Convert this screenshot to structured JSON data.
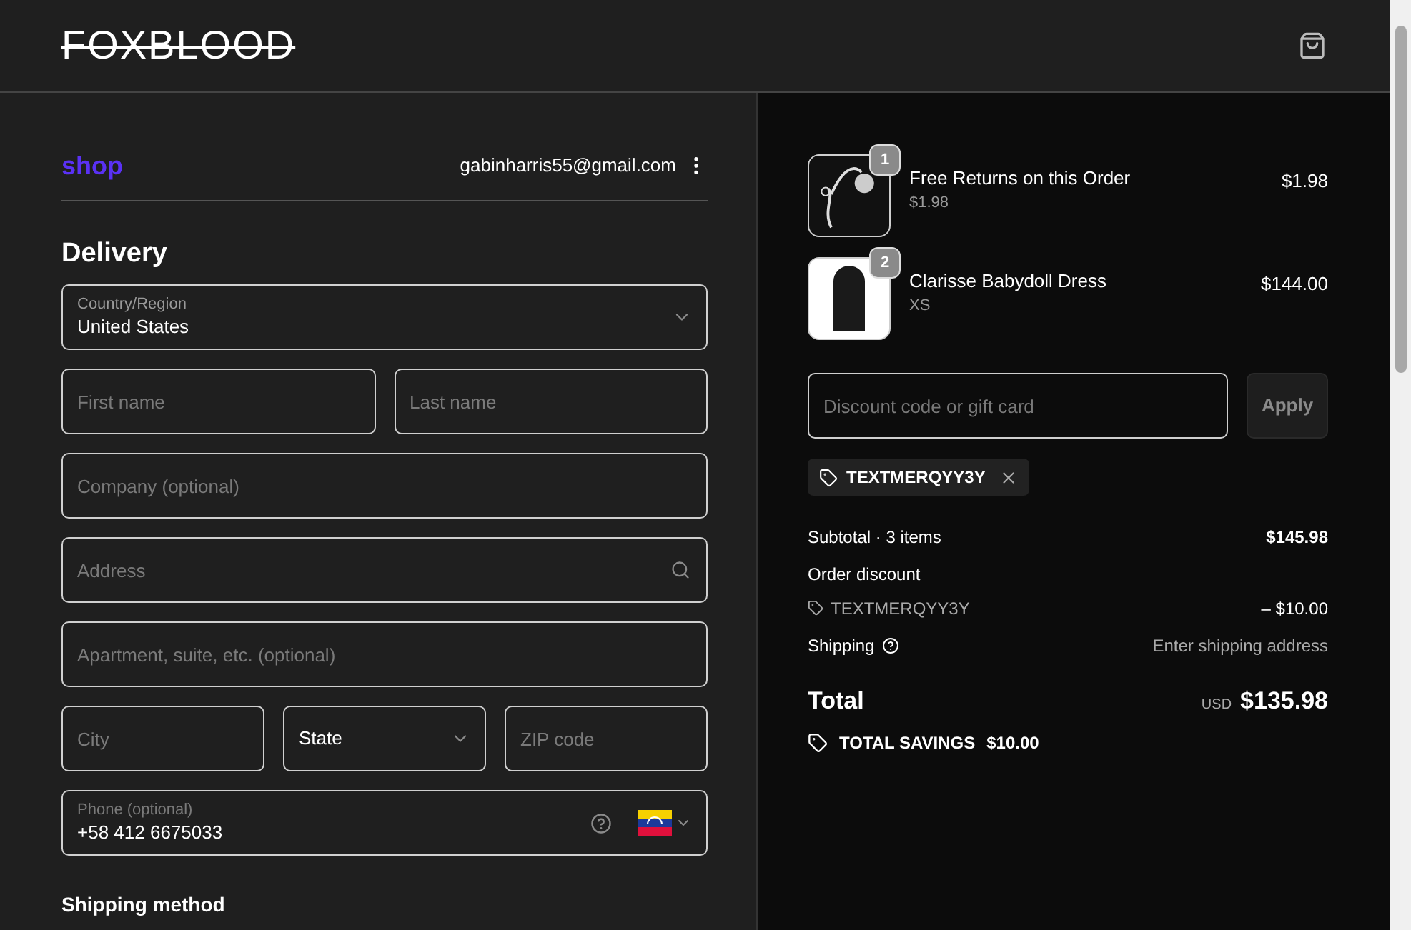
{
  "header": {
    "logo": "FOXBLOOD"
  },
  "account": {
    "shop": "shop",
    "email": "gabinharris55@gmail.com"
  },
  "delivery": {
    "title": "Delivery",
    "rows": [
      [
        {
          "kind": "select",
          "label": "Country/Region",
          "value": "United States"
        }
      ],
      [
        {
          "kind": "text",
          "placeholder": "First name"
        },
        {
          "kind": "text",
          "placeholder": "Last name"
        }
      ],
      [
        {
          "kind": "text",
          "placeholder": "Company (optional)"
        }
      ],
      [
        {
          "kind": "search",
          "placeholder": "Address"
        }
      ],
      [
        {
          "kind": "text",
          "placeholder": "Apartment, suite, etc. (optional)"
        }
      ],
      [
        {
          "kind": "text",
          "placeholder": "City"
        },
        {
          "kind": "select",
          "value": "State"
        },
        {
          "kind": "text",
          "placeholder": "ZIP code"
        }
      ],
      [
        {
          "kind": "phone",
          "label": "Phone (optional)",
          "value": "+58 412 6675033"
        }
      ]
    ]
  },
  "shipping_method": {
    "title": "Shipping method"
  },
  "cart": {
    "items": [
      {
        "name": "Free Returns on this Order",
        "detail": "$1.98",
        "price": "$1.98",
        "quantity": "1",
        "kind": "drawing"
      },
      {
        "name": "Clarisse Babydoll Dress",
        "detail": "XS",
        "price": "$144.00",
        "quantity": "2",
        "kind": "photo"
      }
    ],
    "discount": {
      "placeholder": "Discount code or gift card",
      "button": "Apply"
    },
    "applied_code": "TEXTMERQYY3Y",
    "subtotal": {
      "label": "Subtotal · 3 items",
      "value": "$145.98"
    },
    "order_discount": {
      "label": "Order discount",
      "code": "TEXTMERQYY3Y",
      "value": "– $10.00"
    },
    "shipping": {
      "label": "Shipping",
      "value": "Enter shipping address"
    },
    "total": {
      "label": "Total",
      "currency": "USD",
      "value": "$135.98"
    },
    "savings": {
      "label": "TOTAL SAVINGS",
      "value": "$10.00"
    }
  }
}
